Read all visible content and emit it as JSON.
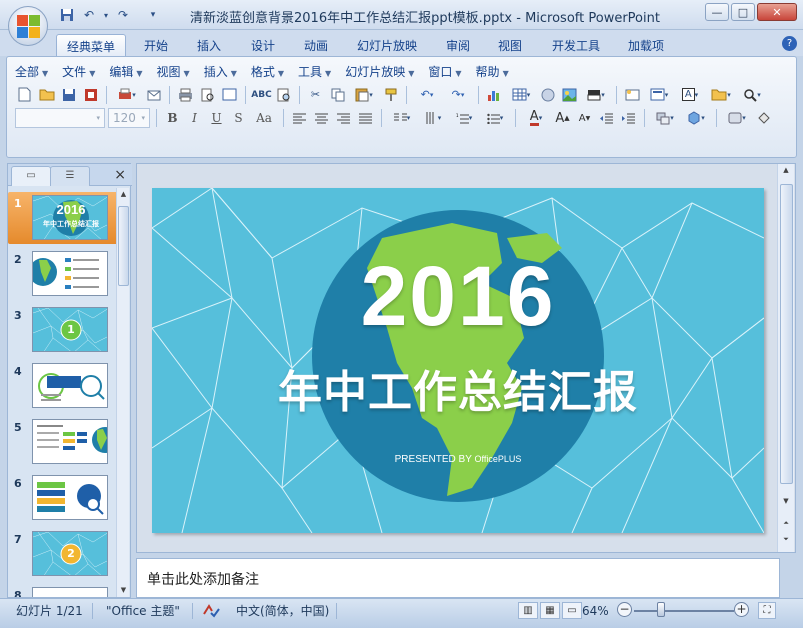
{
  "window": {
    "title": "清新淡蓝创意背景2016年中工作总结汇报ppt模板.pptx - Microsoft PowerPoint",
    "minimize": "—",
    "maximize": "□",
    "close": "✕"
  },
  "quick_access": {
    "save_icon": "save-icon",
    "undo_icon": "undo-icon",
    "redo_icon": "redo-icon",
    "customize_icon": "customize-icon"
  },
  "ribbon": {
    "tabs": [
      "经典菜单",
      "开始",
      "插入",
      "设计",
      "动画",
      "幻灯片放映",
      "审阅",
      "视图",
      "开发工具",
      "加载项"
    ],
    "active_tab": "经典菜单",
    "help": "?",
    "menus": [
      "全部",
      "文件",
      "编辑",
      "视图",
      "插入",
      "格式",
      "工具",
      "幻灯片放映",
      "窗口",
      "帮助"
    ],
    "font_name": "",
    "font_size": "120",
    "format_buttons": [
      "B",
      "I",
      "U",
      "S",
      "Aa"
    ]
  },
  "left_pane": {
    "tab_slides_icon": "slides-tab-icon",
    "tab_outline_icon": "outline-tab-icon",
    "close": "×",
    "thumbnails": [
      {
        "num": "1",
        "selected": true,
        "title": "2016",
        "subtitle": "年中工作总结汇报"
      },
      {
        "num": "2",
        "selected": false
      },
      {
        "num": "3",
        "selected": false,
        "badge": "1",
        "badge_color": "#6cc644"
      },
      {
        "num": "4",
        "selected": false
      },
      {
        "num": "5",
        "selected": false
      },
      {
        "num": "6",
        "selected": false
      },
      {
        "num": "7",
        "selected": false,
        "badge": "2",
        "badge_color": "#f2b630"
      },
      {
        "num": "8",
        "selected": false
      }
    ]
  },
  "slide": {
    "title": "2016",
    "subtitle": "年中工作总结汇报",
    "presented_by": "PRESENTED BY",
    "brand": "OfficePLUS",
    "background": "#56bfdb",
    "globe_color": "#1f7fa8",
    "land_color": "#8bcf4a"
  },
  "notes": {
    "placeholder": "单击此处添加备注"
  },
  "status": {
    "slide_info": "幻灯片 1/21",
    "theme": "\"Office 主题\"",
    "language": "中文(简体，中国)",
    "zoom": "64%",
    "zoom_out": "−",
    "zoom_in": "+"
  }
}
